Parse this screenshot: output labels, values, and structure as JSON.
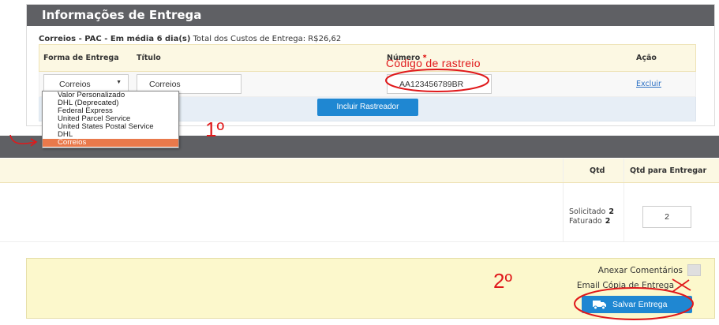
{
  "delivery_panel": {
    "title": "Informações de Entrega",
    "summary_bold": "Correios - PAC - Em média 6 dia(s)",
    "summary_rest": "Total dos Custos de Entrega: R$26,62",
    "columns": {
      "method": "Forma de Entrega",
      "title": "Título",
      "number": "Número",
      "required_mark": "*",
      "action": "Ação"
    },
    "row": {
      "method_value": "Correios",
      "title_value": "Correios",
      "number_value": "AA123456789BR",
      "delete_label": "Excluir"
    },
    "include_button": "Incluir Rastreador"
  },
  "dropdown": {
    "options": [
      "Valor Personalizado",
      "DHL (Deprecated)",
      "Federal Express",
      "United Parcel Service",
      "United States Postal Service",
      "DHL",
      "Correios"
    ],
    "selected": "Correios"
  },
  "products": {
    "qty_header": "Qtd",
    "qty_to_deliver_header": "Qtd para Entregar",
    "requested_label": "Solicitado",
    "requested_value": "2",
    "invoiced_label": "Faturado",
    "invoiced_value": "2",
    "qty_to_deliver_value": "2"
  },
  "save_panel": {
    "attach_comments": "Anexar Comentários",
    "email_copy": "Email Cópia de Entrega",
    "save_button": "Salvar Entrega"
  },
  "annotations": {
    "tracking_code": "Código de rastreio",
    "step1": "1º",
    "step2": "2º"
  },
  "colors": {
    "header_bg": "#5f6064",
    "accent_blue": "#1f87d2",
    "selected_option": "#e9794b",
    "annotation_red": "#e0191b",
    "table_header_bg": "#fcf8e3",
    "save_panel_bg": "#fcf8cc"
  }
}
